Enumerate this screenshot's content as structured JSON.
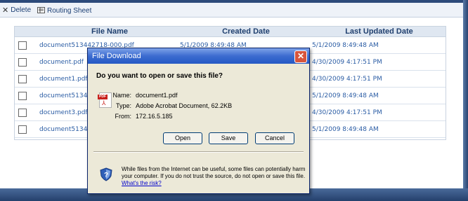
{
  "toolbar": {
    "delete_label": "Delete",
    "routing_label": "Routing Sheet"
  },
  "table": {
    "columns": [
      "File Name",
      "Created Date",
      "Last Updated Date"
    ],
    "rows": [
      {
        "name": "document513442718-000.pdf",
        "created": "5/1/2009 8:49:48 AM",
        "updated": "5/1/2009 8:49:48 AM"
      },
      {
        "name": "document.pdf",
        "created": "",
        "updated": "4/30/2009 4:17:51 PM"
      },
      {
        "name": "document1.pdf",
        "created": "",
        "updated": "4/30/2009 4:17:51 PM"
      },
      {
        "name": "document5134",
        "created": "",
        "updated": "5/1/2009 8:49:48 AM"
      },
      {
        "name": "document3.pdf",
        "created": "",
        "updated": "4/30/2009 4:17:51 PM"
      },
      {
        "name": "document5134",
        "created": "",
        "updated": "5/1/2009 8:49:48 AM"
      }
    ]
  },
  "dialog": {
    "title": "File Download",
    "close": "✕",
    "question": "Do you want to open or save this file?",
    "name_label": "Name:",
    "name_value": "document1.pdf",
    "type_label": "Type:",
    "type_value": "Adobe Acrobat Document, 62.2KB",
    "from_label": "From:",
    "from_value": "172.16.5.185",
    "open_label": "Open",
    "save_label": "Save",
    "cancel_label": "Cancel",
    "warning_text": "While files from the Internet can be useful, some files can potentially harm your computer. If you do not trust the source, do not open or save this file.",
    "risk_link": "What's the risk?",
    "pdf_tag": "PDF"
  },
  "icons": {
    "delete": "delete-icon",
    "routing": "routing-sheet-icon",
    "pdf": "pdf-file-icon",
    "shield": "shield-icon"
  },
  "colors": {
    "header_bg": "#dfe7f1",
    "link": "#2a5ca4",
    "title_bar": "#2458c4",
    "close": "#d8553c"
  }
}
